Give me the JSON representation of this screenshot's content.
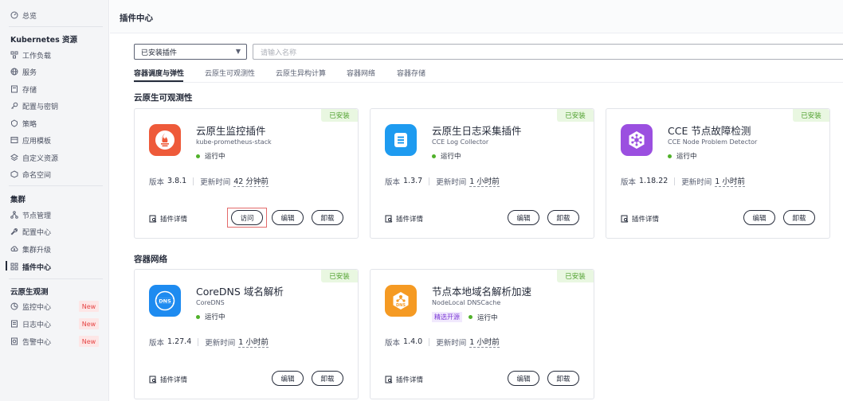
{
  "sidebar": {
    "overview": "总览",
    "group_k8s": "Kubernetes 资源",
    "k8s_items": [
      "工作负载",
      "服务",
      "存储",
      "配置与密钥",
      "策略",
      "应用模板",
      "自定义资源",
      "命名空间"
    ],
    "group_cluster": "集群",
    "cluster_items": [
      "节点管理",
      "配置中心",
      "集群升级",
      "插件中心"
    ],
    "group_observe": "云原生观测",
    "observe_items": [
      "监控中心",
      "日志中心",
      "告警中心"
    ],
    "new_badge": "New"
  },
  "header": {
    "title": "插件中心"
  },
  "filter": {
    "select_value": "已安装插件",
    "search_placeholder": "请输入名称"
  },
  "tabs": [
    "容器调度与弹性",
    "云原生可观测性",
    "云原生异构计算",
    "容器网络",
    "容器存储"
  ],
  "sections": {
    "observability": "云原生可观测性",
    "network": "容器网络"
  },
  "labels": {
    "installed": "已安装",
    "version": "版本",
    "updated": "更新时间",
    "detail": "插件详情",
    "visit": "访问",
    "edit": "编辑",
    "uninstall": "卸载",
    "running": "运行中",
    "featured_open": "精选开源"
  },
  "plugins": [
    {
      "name": "云原生监控插件",
      "id": "kube-prometheus-stack",
      "version": "3.8.1",
      "updated": "42 分钟前",
      "logo_color": "#ee5a3a",
      "icon": "prometheus-icon"
    },
    {
      "name": "云原生日志采集插件",
      "id": "CCE Log Collector",
      "version": "1.3.7",
      "updated": "1 小时前",
      "logo_color": "#1e9bf0",
      "icon": "log-icon"
    },
    {
      "name": "CCE 节点故障检测",
      "id": "CCE Node Problem Detector",
      "version": "1.18.22",
      "updated": "1 小时前",
      "logo_color": "#9b4fe0",
      "icon": "hub-icon"
    },
    {
      "name": "CoreDNS 域名解析",
      "id": "CoreDNS",
      "version": "1.27.4",
      "updated": "1 小时前",
      "logo_color": "#1e8bf0",
      "icon": "dns-icon"
    },
    {
      "name": "节点本地域名解析加速",
      "id": "NodeLocal DNSCache",
      "version": "1.4.0",
      "updated": "1 小时前",
      "logo_color": "#f59a23",
      "icon": "dns-hex-icon"
    }
  ]
}
